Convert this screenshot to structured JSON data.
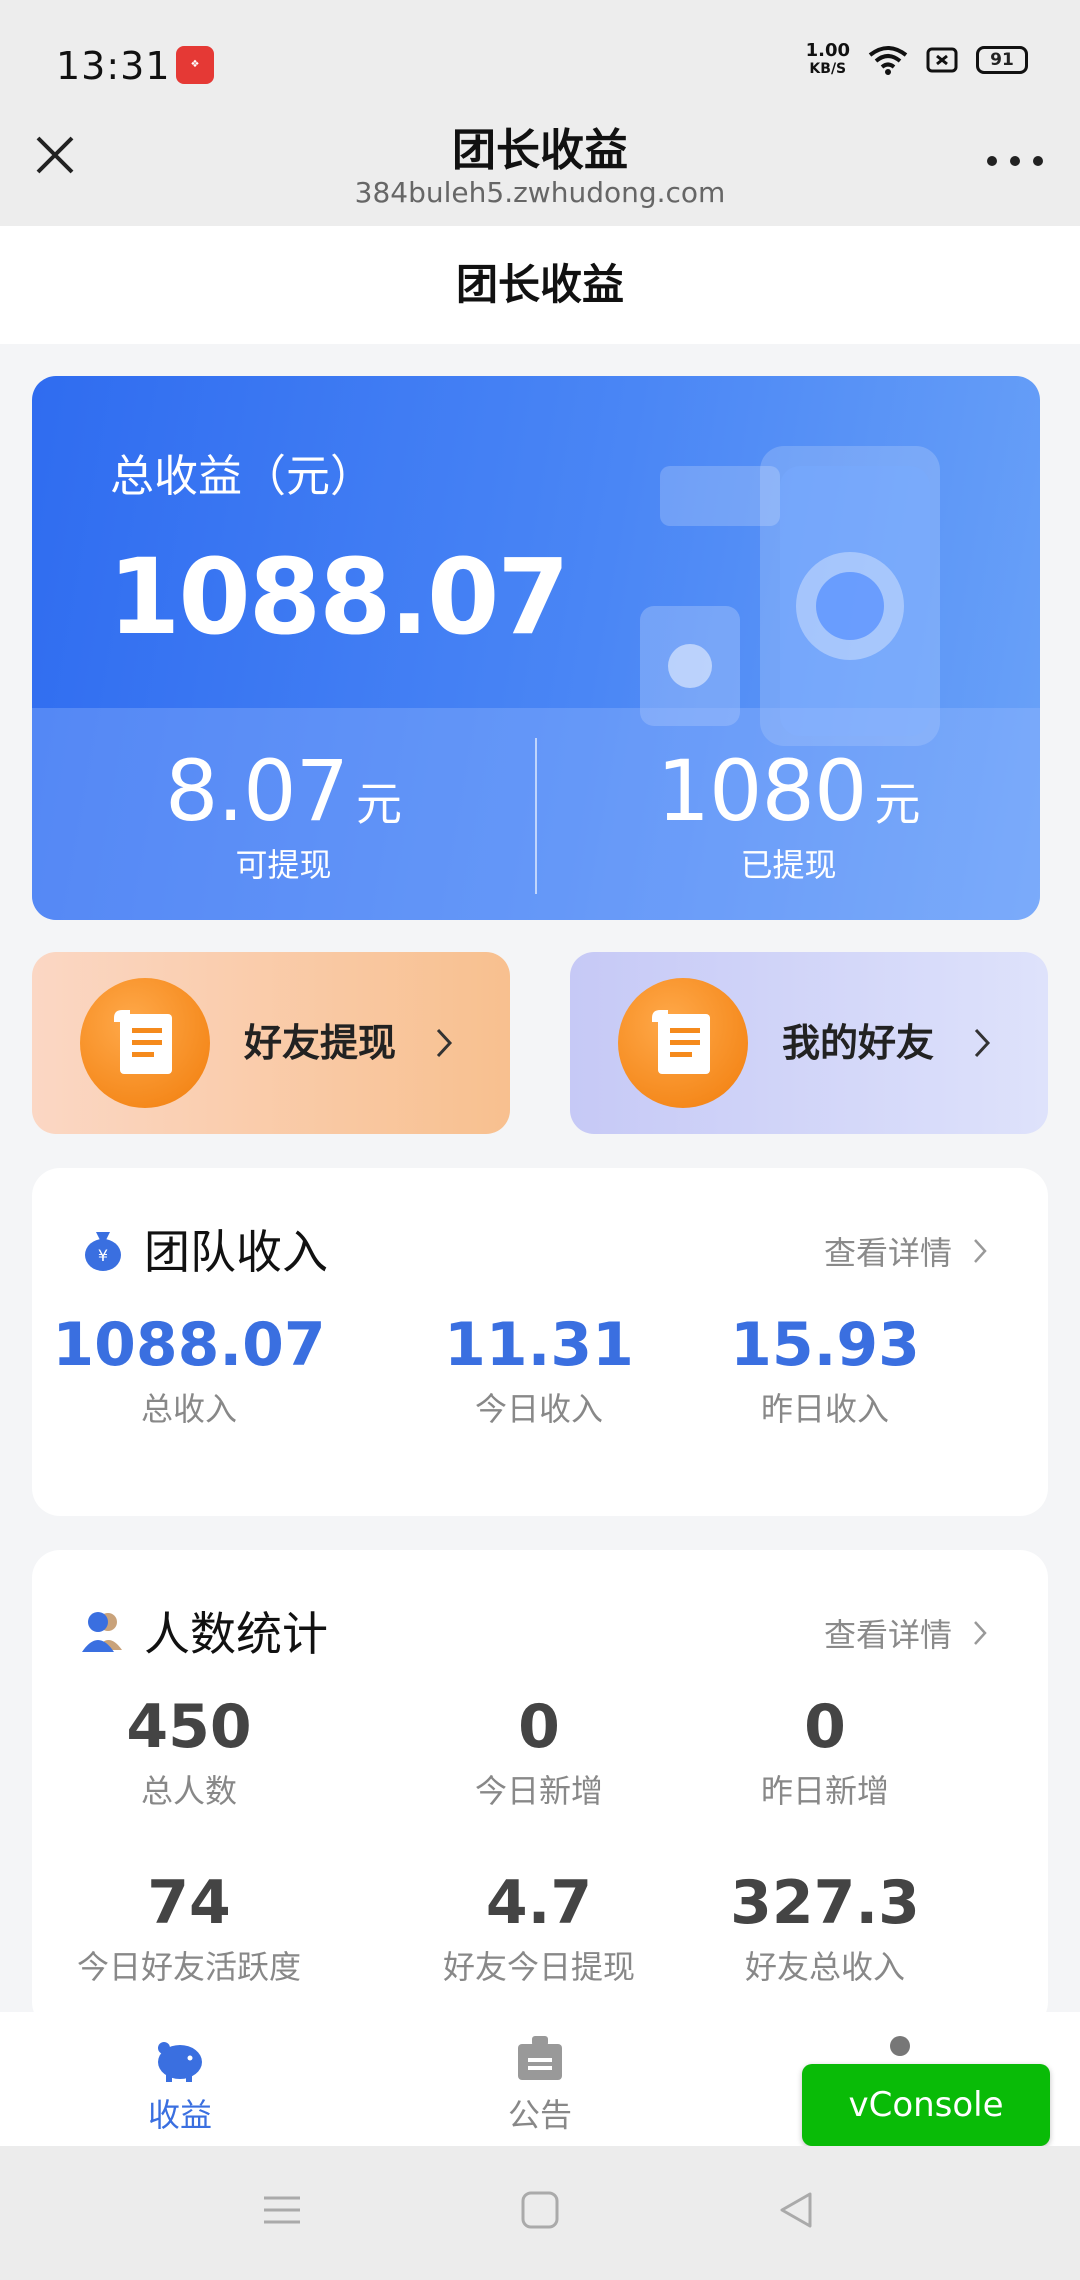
{
  "status_bar": {
    "time": "13:31",
    "net_speed_value": "1.00",
    "net_speed_unit": "KB/S",
    "battery": "91",
    "icons": [
      "app-icon",
      "wifi-icon",
      "sim-icon",
      "battery-icon"
    ]
  },
  "title_bar": {
    "title": "团长收益",
    "url": "384buleh5.zwhudong.com"
  },
  "page": {
    "header": "团长收益"
  },
  "summary": {
    "label": "总收益（元）",
    "total": "1088.07",
    "withdrawable_value": "8.07",
    "withdrawable_unit": "元",
    "withdrawable_label": "可提现",
    "withdrawn_value": "1080",
    "withdrawn_unit": "元",
    "withdrawn_label": "已提现"
  },
  "quick_actions": {
    "friend_withdraw": "好友提现",
    "my_friends": "我的好友"
  },
  "team_income": {
    "title": "团队收入",
    "link": "查看详情",
    "stats": [
      {
        "value": "1088.07",
        "label": "总收入"
      },
      {
        "value": "11.31",
        "label": "今日收入"
      },
      {
        "value": "15.93",
        "label": "昨日收入"
      }
    ]
  },
  "people_stats": {
    "title": "人数统计",
    "link": "查看详情",
    "stats": [
      {
        "value": "450",
        "label": "总人数"
      },
      {
        "value": "0",
        "label": "今日新增"
      },
      {
        "value": "0",
        "label": "昨日新增"
      },
      {
        "value": "74",
        "label": "今日好友活跃度"
      },
      {
        "value": "4.7",
        "label": "好友今日提现"
      },
      {
        "value": "327.3",
        "label": "好友总收入"
      }
    ]
  },
  "bottom_nav": {
    "items": [
      {
        "label": "收益",
        "icon": "piggy-bank-icon",
        "active": true
      },
      {
        "label": "公告",
        "icon": "notice-icon",
        "active": false
      }
    ],
    "vconsole": "vConsole"
  },
  "colors": {
    "accent": "#3a6fe0",
    "hero_start": "#2f6cf0",
    "hero_end": "#6aa2f8",
    "orange": "#f17d0b",
    "vconsole_green": "#09bb07"
  }
}
